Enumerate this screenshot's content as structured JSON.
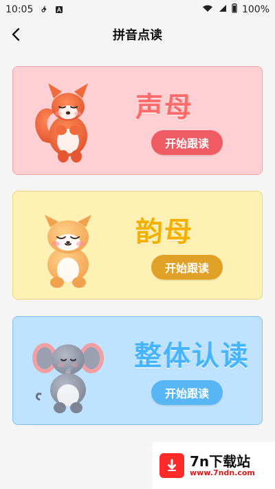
{
  "status_bar": {
    "time": "10:05",
    "battery": "100%"
  },
  "header": {
    "title": "拼音点读"
  },
  "cards": [
    {
      "title": "声母",
      "button": "开始跟读"
    },
    {
      "title": "韵母",
      "button": "开始跟读"
    },
    {
      "title": "整体认读",
      "button": "开始跟读"
    }
  ],
  "watermark": {
    "title": "7n下载站",
    "url": "www.7ndn.com"
  }
}
